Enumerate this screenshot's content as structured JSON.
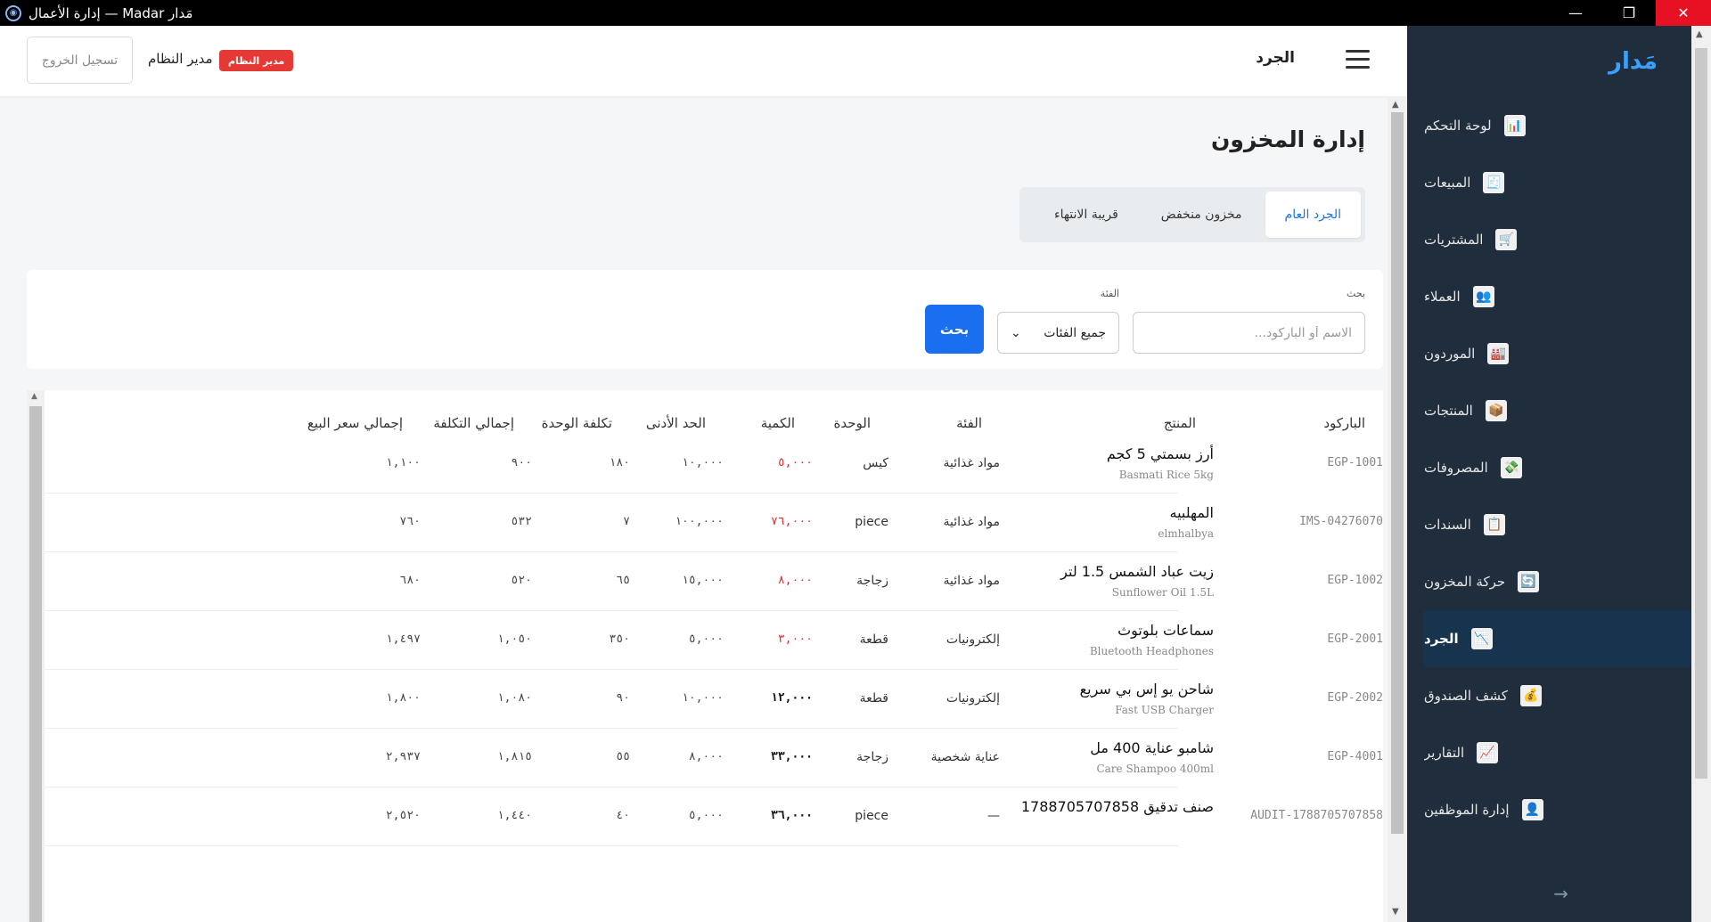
{
  "window": {
    "title": "إدارة الأعمال — Madar مَدار",
    "minimize": "—",
    "restore": "❐",
    "close": "✕"
  },
  "sidebar": {
    "brand": "مَدار",
    "items": [
      {
        "label": "لوحة التحكم",
        "icon": "📊"
      },
      {
        "label": "المبيعات",
        "icon": "🧾"
      },
      {
        "label": "المشتريات",
        "icon": "🛒"
      },
      {
        "label": "العملاء",
        "icon": "👥"
      },
      {
        "label": "الموردون",
        "icon": "🏭"
      },
      {
        "label": "المنتجات",
        "icon": "📦"
      },
      {
        "label": "المصروفات",
        "icon": "💸"
      },
      {
        "label": "السندات",
        "icon": "📋"
      },
      {
        "label": "حركة المخزون",
        "icon": "🔄"
      },
      {
        "label": "الجرد",
        "icon": "📉"
      },
      {
        "label": "كشف الصندوق",
        "icon": "💰"
      },
      {
        "label": "التقارير",
        "icon": "📈"
      },
      {
        "label": "إدارة الموظفين",
        "icon": "👤"
      }
    ],
    "active_index": 9,
    "collapse": "→"
  },
  "topbar": {
    "logout": "تسجيل الخروج",
    "user": "مدير النظام",
    "role": "مدير النظام",
    "page": "الجرد"
  },
  "page": {
    "title": "إدارة المخزون",
    "tabs": [
      "الجرد العام",
      "مخزون منخفض",
      "قريبة الانتهاء"
    ],
    "active_tab": 0
  },
  "filters": {
    "search_label": "بحث",
    "search_placeholder": "الاسم أو الباركود...",
    "category_label": "الفئة",
    "category_value": "جميع الفئات",
    "search_button": "بحث"
  },
  "table": {
    "headers": [
      "الباركود",
      "المنتج",
      "الفئة",
      "الوحدة",
      "الكمية",
      "الحد الأدنى",
      "تكلفة الوحدة",
      "إجمالي التكلفة",
      "إجمالي سعر البيع"
    ],
    "rows": [
      {
        "barcode": "EGP-1001",
        "name": "أرز بسمتي 5 كجم",
        "sub": "Basmati Rice 5kg",
        "category": "مواد غذائية",
        "unit": "كيس",
        "qty": "٥,٠٠٠",
        "qty_low": true,
        "min": "١٠,٠٠٠",
        "unit_cost": "١٨٠",
        "total_cost": "٩٠٠",
        "total_sale": "١,١٠٠"
      },
      {
        "barcode": "IMS-04276070",
        "name": "المهلبيه",
        "sub": "elmhalbya",
        "category": "مواد غذائية",
        "unit": "piece",
        "qty": "٧٦,٠٠٠",
        "qty_low": true,
        "min": "١٠٠,٠٠٠",
        "unit_cost": "٧",
        "total_cost": "٥٣٢",
        "total_sale": "٧٦٠"
      },
      {
        "barcode": "EGP-1002",
        "name": "زيت عباد الشمس 1.5 لتر",
        "sub": "Sunflower Oil 1.5L",
        "category": "مواد غذائية",
        "unit": "زجاجة",
        "qty": "٨,٠٠٠",
        "qty_low": true,
        "min": "١٥,٠٠٠",
        "unit_cost": "٦٥",
        "total_cost": "٥٢٠",
        "total_sale": "٦٨٠"
      },
      {
        "barcode": "EGP-2001",
        "name": "سماعات بلوتوث",
        "sub": "Bluetooth Headphones",
        "category": "إلكترونيات",
        "unit": "قطعة",
        "qty": "٣,٠٠٠",
        "qty_low": true,
        "min": "٥,٠٠٠",
        "unit_cost": "٣٥٠",
        "total_cost": "١,٠٥٠",
        "total_sale": "١,٤٩٧"
      },
      {
        "barcode": "EGP-2002",
        "name": "شاحن يو إس بي سريع",
        "sub": "Fast USB Charger",
        "category": "إلكترونيات",
        "unit": "قطعة",
        "qty": "١٢,٠٠٠",
        "qty_low": false,
        "min": "١٠,٠٠٠",
        "unit_cost": "٩٠",
        "total_cost": "١,٠٨٠",
        "total_sale": "١,٨٠٠"
      },
      {
        "barcode": "EGP-4001",
        "name": "شامبو عناية 400 مل",
        "sub": "Care Shampoo 400ml",
        "category": "عناية شخصية",
        "unit": "زجاجة",
        "qty": "٣٣,٠٠٠",
        "qty_low": false,
        "min": "٨,٠٠٠",
        "unit_cost": "٥٥",
        "total_cost": "١,٨١٥",
        "total_sale": "٢,٩٣٧"
      },
      {
        "barcode": "AUDIT-1788705707858",
        "name": "صنف تدقيق 1788705707858",
        "sub": "",
        "category": "—",
        "unit": "piece",
        "qty": "٣٦,٠٠٠",
        "qty_low": false,
        "min": "٥,٠٠٠",
        "unit_cost": "٤٠",
        "total_cost": "١,٤٤٠",
        "total_sale": "٢,٥٢٠"
      }
    ]
  },
  "colors": {
    "sidebar_bg": "#1f2d3d",
    "active_bg": "#18334e",
    "accent": "#1a6ff0",
    "danger": "#d32f2f"
  }
}
